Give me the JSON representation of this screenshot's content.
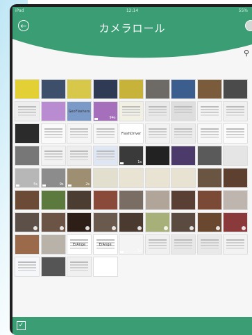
{
  "statusbar": {
    "carrier": "iPad",
    "time": "12:14",
    "battery": "55%"
  },
  "header": {
    "title": "カメラロール",
    "back_icon": "back-arrow-icon",
    "corner_icon": "select-circle-icon"
  },
  "colors": {
    "accent": "#3a9d73",
    "background": "#f6f6f6"
  },
  "grid": {
    "cells": [
      {
        "c": "#e2d034",
        "type": "photo"
      },
      {
        "c": "#3d4f6a",
        "type": "photo"
      },
      {
        "c": "#d8c84a",
        "type": "photo"
      },
      {
        "c": "#2f3b55",
        "type": "photo"
      },
      {
        "c": "#c8b33a",
        "type": "photo"
      },
      {
        "c": "#6e6a66",
        "type": "photo"
      },
      {
        "c": "#3b5e8e",
        "type": "photo"
      },
      {
        "c": "#7a5b3c",
        "type": "photo"
      },
      {
        "c": "#4b4b4b",
        "type": "photo"
      },
      {
        "c": "#eeeeee",
        "type": "doc"
      },
      {
        "c": "#b98bd0",
        "type": "photo"
      },
      {
        "c": "#7c9ac8",
        "type": "photo",
        "text": "GeoFlashers"
      },
      {
        "c": "#a56fbc",
        "type": "photo",
        "label": "94s"
      },
      {
        "c": "#f2efe3",
        "type": "doc"
      },
      {
        "c": "#e9e9e9",
        "type": "doc"
      },
      {
        "c": "#dedede",
        "type": "doc"
      },
      {
        "c": "#f4f4f4",
        "type": "doc"
      },
      {
        "c": "#f0f0f0",
        "type": "doc"
      },
      {
        "c": "#2b2b2b",
        "type": "photo"
      },
      {
        "c": "#fafafa",
        "type": "doc"
      },
      {
        "c": "#f5f5f5",
        "type": "doc"
      },
      {
        "c": "#f7f7f7",
        "type": "doc"
      },
      {
        "c": "#ffffff",
        "type": "photo",
        "text": "FlashDriver"
      },
      {
        "c": "#f2f2f2",
        "type": "doc"
      },
      {
        "c": "#ececec",
        "type": "doc"
      },
      {
        "c": "#f8f8f8",
        "type": "doc"
      },
      {
        "c": "#fbfbfb",
        "type": "doc"
      },
      {
        "c": "#777777",
        "type": "photo"
      },
      {
        "c": "#f2f2f2",
        "type": "doc"
      },
      {
        "c": "#eeeeee",
        "type": "doc"
      },
      {
        "c": "#dfe7f5",
        "type": "doc"
      },
      {
        "c": "#3a3a3a",
        "type": "photo",
        "label": "1s"
      },
      {
        "c": "#222222",
        "type": "photo"
      },
      {
        "c": "#4b3a6a",
        "type": "photo"
      },
      {
        "c": "#5a5a5a",
        "type": "photo"
      },
      {
        "c": "#e5e5e5",
        "type": "photo"
      },
      {
        "c": "#b7b7b7",
        "type": "photo",
        "label": "5s"
      },
      {
        "c": "#8c8c8c",
        "type": "photo",
        "label": "9s"
      },
      {
        "c": "#9e8f72",
        "type": "photo",
        "label": "2s"
      },
      {
        "c": "#e3dfcf",
        "type": "photo"
      },
      {
        "c": "#e8e3d2",
        "type": "photo"
      },
      {
        "c": "#e8e3d2",
        "type": "photo"
      },
      {
        "c": "#e7e2d2",
        "type": "photo"
      },
      {
        "c": "#6a5542",
        "type": "photo"
      },
      {
        "c": "#5e4030",
        "type": "photo"
      },
      {
        "c": "#6b4a36",
        "type": "photo"
      },
      {
        "c": "#5d7a3e",
        "type": "photo"
      },
      {
        "c": "#4c3d32",
        "type": "photo"
      },
      {
        "c": "#8a4a3a",
        "type": "photo"
      },
      {
        "c": "#7a6e64",
        "type": "photo"
      },
      {
        "c": "#b1a59a",
        "type": "photo"
      },
      {
        "c": "#5a4034",
        "type": "photo"
      },
      {
        "c": "#7a4a36",
        "type": "photo"
      },
      {
        "c": "#bdb5ae",
        "type": "photo"
      },
      {
        "c": "#5d5048",
        "type": "photo",
        "check": true
      },
      {
        "c": "#6b5446",
        "type": "photo",
        "check": true
      },
      {
        "c": "#2d1f18",
        "type": "photo",
        "check": true
      },
      {
        "c": "#6a5a4e",
        "type": "photo",
        "check": true
      },
      {
        "c": "#4a3a30",
        "type": "photo",
        "check": true
      },
      {
        "c": "#a8b07a",
        "type": "photo",
        "check": true
      },
      {
        "c": "#5a4a40",
        "type": "photo",
        "check": true
      },
      {
        "c": "#6a4830",
        "type": "photo",
        "check": true
      },
      {
        "c": "#8a3a3a",
        "type": "photo",
        "check": true
      },
      {
        "c": "#9a6a4a",
        "type": "photo"
      },
      {
        "c": "#b9b2a8",
        "type": "photo"
      },
      {
        "c": "#ffffff",
        "type": "doc",
        "text": "ErAnge"
      },
      {
        "c": "#ffffff",
        "type": "doc",
        "text": "ErAnge"
      },
      {
        "c": "#f4f4f4",
        "type": "photo",
        "label": "5s"
      },
      {
        "c": "#f0f0f0",
        "type": "doc"
      },
      {
        "c": "#e8e8e8",
        "type": "doc"
      },
      {
        "c": "#e9e9e9",
        "type": "doc"
      },
      {
        "c": "#f2f2f2",
        "type": "doc"
      },
      {
        "c": "#f5f7fb",
        "type": "doc"
      },
      {
        "c": "#555555",
        "type": "photo"
      },
      {
        "c": "#f0f0f0",
        "type": "doc"
      },
      {
        "c": "#ffffff",
        "type": "photo"
      }
    ]
  },
  "bottombar": {
    "select_icon": "select-checkbox-icon"
  }
}
